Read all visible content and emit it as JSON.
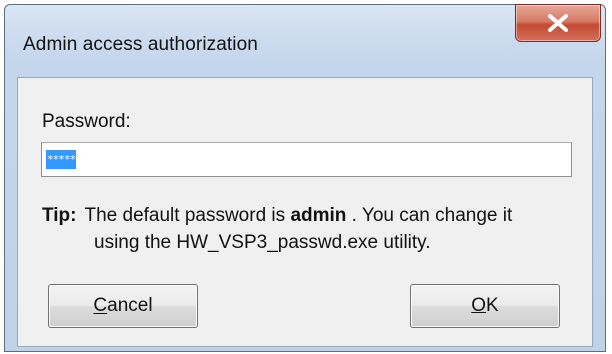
{
  "window": {
    "title": "Admin access authorization",
    "close_icon": "close-icon"
  },
  "password": {
    "label": "Password:",
    "value": "*****"
  },
  "tip": {
    "heading": "Tip:",
    "text_before": "The default password is ",
    "default_password": "admin",
    "text_after": " . You can change it",
    "line2": "using the HW_VSP3_passwd.exe utility."
  },
  "buttons": {
    "cancel_label": "Cancel",
    "ok_label": "OK"
  },
  "colors": {
    "selection": "#3399ff",
    "close_button": "#c44b33",
    "title_bar": "#cddcef"
  }
}
